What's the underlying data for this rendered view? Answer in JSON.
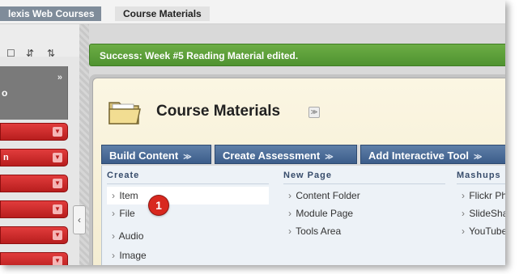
{
  "breadcrumb": {
    "first": "lexis Web Courses",
    "current": "Course Materials"
  },
  "sidebar": {
    "tool_glyphs": [
      "☐",
      "⇵",
      "⇅"
    ],
    "expand_glyph": "»",
    "header_fragment": "o",
    "items": [
      {
        "fragment": ""
      },
      {
        "fragment": "n"
      },
      {
        "fragment": ""
      },
      {
        "fragment": ""
      },
      {
        "fragment": ""
      },
      {
        "fragment": ""
      }
    ],
    "collapse_glyph": "‹"
  },
  "alert": {
    "text": "Success: Week #5 Reading Material edited."
  },
  "page": {
    "title": "Course Materials",
    "title_menu_glyph": "≫"
  },
  "actions": [
    {
      "label": "Build Content"
    },
    {
      "label": "Create Assessment"
    },
    {
      "label": "Add Interactive Tool"
    }
  ],
  "action_chevron": "≫",
  "dropdown": {
    "columns": [
      {
        "heading": "Create",
        "items": [
          "Item",
          "File",
          "Audio",
          "Image"
        ]
      },
      {
        "heading": "New Page",
        "items": [
          "Content Folder",
          "Module Page",
          "Tools Area"
        ]
      },
      {
        "heading": "Mashups",
        "items": [
          "Flickr Pho",
          "SlideShar",
          "YouTube"
        ]
      }
    ],
    "item_arrow": "›"
  },
  "callout": {
    "number": "1"
  },
  "colors": {
    "success_green": "#5a9d36",
    "action_blue": "#4a6b96",
    "sidebar_red": "#cc2a2a",
    "callout_red": "#d8281f"
  }
}
